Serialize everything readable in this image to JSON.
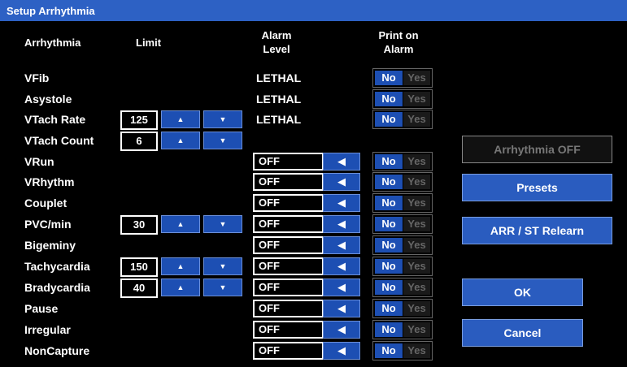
{
  "window": {
    "title": "Setup Arrhythmia"
  },
  "headers": {
    "arrhythmia": "Arrhythmia",
    "limit": "Limit",
    "alarm_level_line1": "Alarm",
    "alarm_level_line2": "Level",
    "print_line1": "Print on",
    "print_line2": "Alarm"
  },
  "rows": [
    {
      "name": "VFib",
      "level": "LETHAL",
      "print_no": "No",
      "print_yes": "Yes"
    },
    {
      "name": "Asystole",
      "level": "LETHAL",
      "print_no": "No",
      "print_yes": "Yes"
    },
    {
      "name": "VTach Rate",
      "limit": "125",
      "level": "LETHAL",
      "print_no": "No",
      "print_yes": "Yes"
    },
    {
      "name": "VTach Count",
      "limit": "6"
    },
    {
      "name": "VRun",
      "level": "OFF",
      "print_no": "No",
      "print_yes": "Yes"
    },
    {
      "name": "VRhythm",
      "level": "OFF",
      "print_no": "No",
      "print_yes": "Yes"
    },
    {
      "name": "Couplet",
      "level": "OFF",
      "print_no": "No",
      "print_yes": "Yes"
    },
    {
      "name": "PVC/min",
      "limit": "30",
      "level": "OFF",
      "print_no": "No",
      "print_yes": "Yes"
    },
    {
      "name": "Bigeminy",
      "level": "OFF",
      "print_no": "No",
      "print_yes": "Yes"
    },
    {
      "name": "Tachycardia",
      "limit": "150",
      "level": "OFF",
      "print_no": "No",
      "print_yes": "Yes"
    },
    {
      "name": "Bradycardia",
      "limit": "40",
      "level": "OFF",
      "print_no": "No",
      "print_yes": "Yes"
    },
    {
      "name": "Pause",
      "level": "OFF",
      "print_no": "No",
      "print_yes": "Yes"
    },
    {
      "name": "Irregular",
      "level": "OFF",
      "print_no": "No",
      "print_yes": "Yes"
    },
    {
      "name": "NonCapture",
      "level": "OFF",
      "print_no": "No",
      "print_yes": "Yes"
    }
  ],
  "buttons": {
    "arrhythmia_off": "Arrhythmia OFF",
    "presets": "Presets",
    "relearn": "ARR / ST Relearn",
    "ok": "OK",
    "cancel": "Cancel"
  },
  "icons": {
    "up": "up-arrow-icon",
    "down": "down-arrow-icon",
    "left": "left-arrow-icon"
  },
  "colors": {
    "title_bar": "#2d61c4",
    "button": "#1d4fb3",
    "background": "#000000"
  }
}
